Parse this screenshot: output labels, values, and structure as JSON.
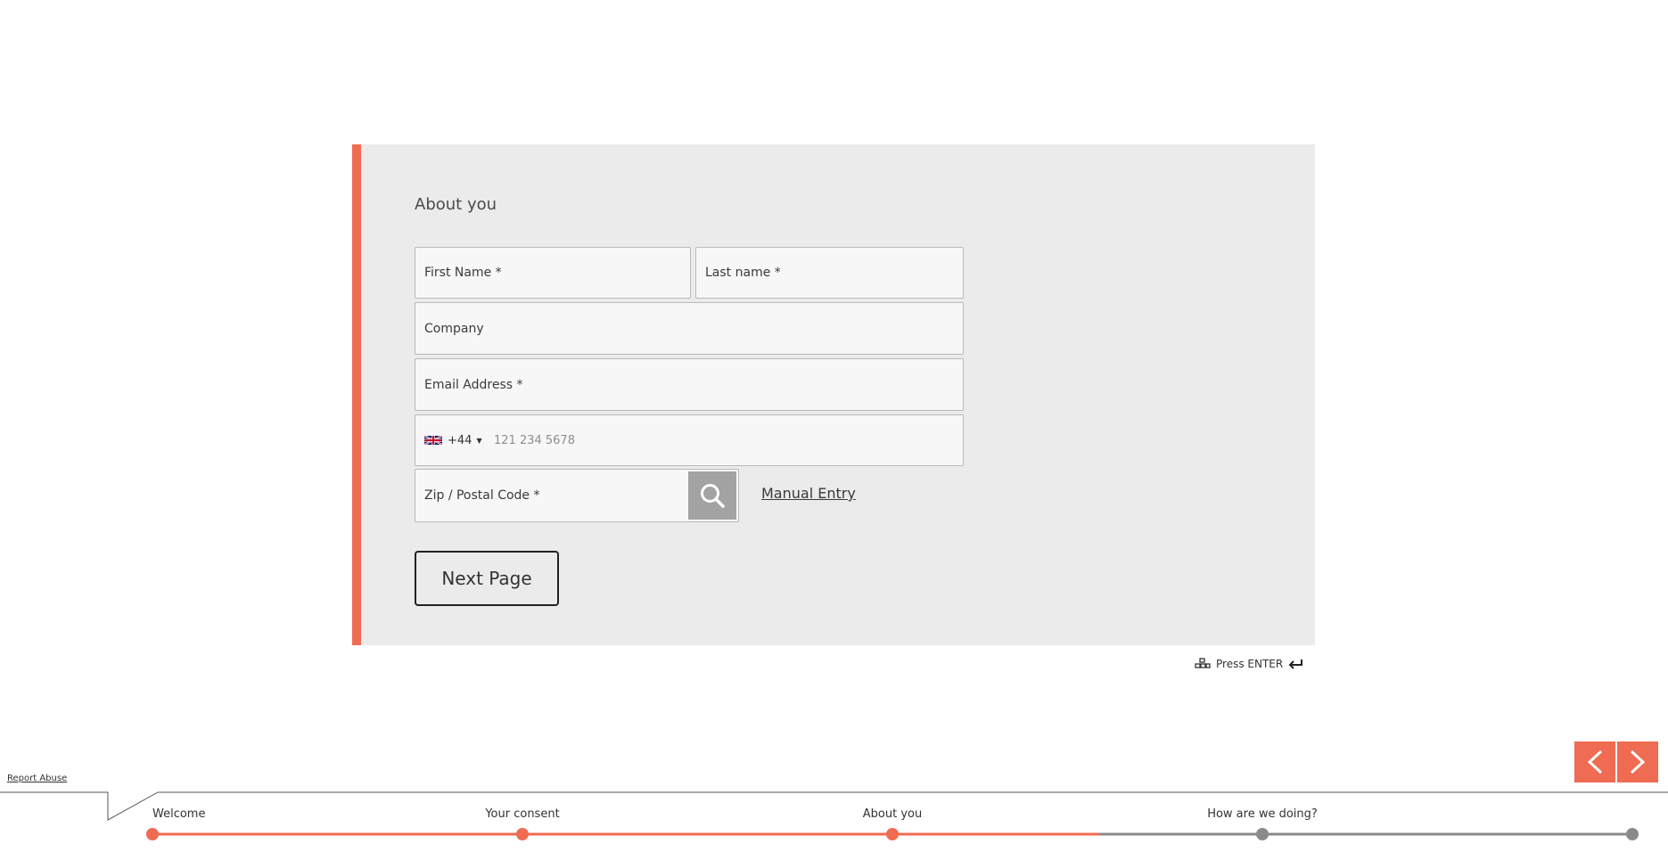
{
  "form": {
    "section_title": "About you",
    "fields": {
      "first_name_placeholder": "First Name *",
      "last_name_placeholder": "Last name *",
      "company_placeholder": "Company",
      "email_placeholder": "Email Address *",
      "phone_country_code": "+44",
      "phone_placeholder": "121 234 5678",
      "zip_placeholder": "Zip / Postal Code *"
    },
    "manual_entry_label": "Manual Entry",
    "next_button_label": "Next Page"
  },
  "hint": {
    "text": "Press ENTER"
  },
  "footer": {
    "report_abuse_label": "Report Abuse",
    "steps": [
      "Welcome",
      "Your consent",
      "About you",
      "How are we doing?"
    ],
    "progress_fraction": 0.64
  },
  "colors": {
    "accent": "#ef6b51",
    "card_bg": "#ebebeb",
    "inactive": "#8a8a8a"
  },
  "icons": {
    "search": "search-icon",
    "keyboard": "keyboard-icon",
    "enter": "enter-return-icon",
    "prev": "chevron-left-icon",
    "next": "chevron-right-icon",
    "flag": "uk-flag-icon"
  }
}
